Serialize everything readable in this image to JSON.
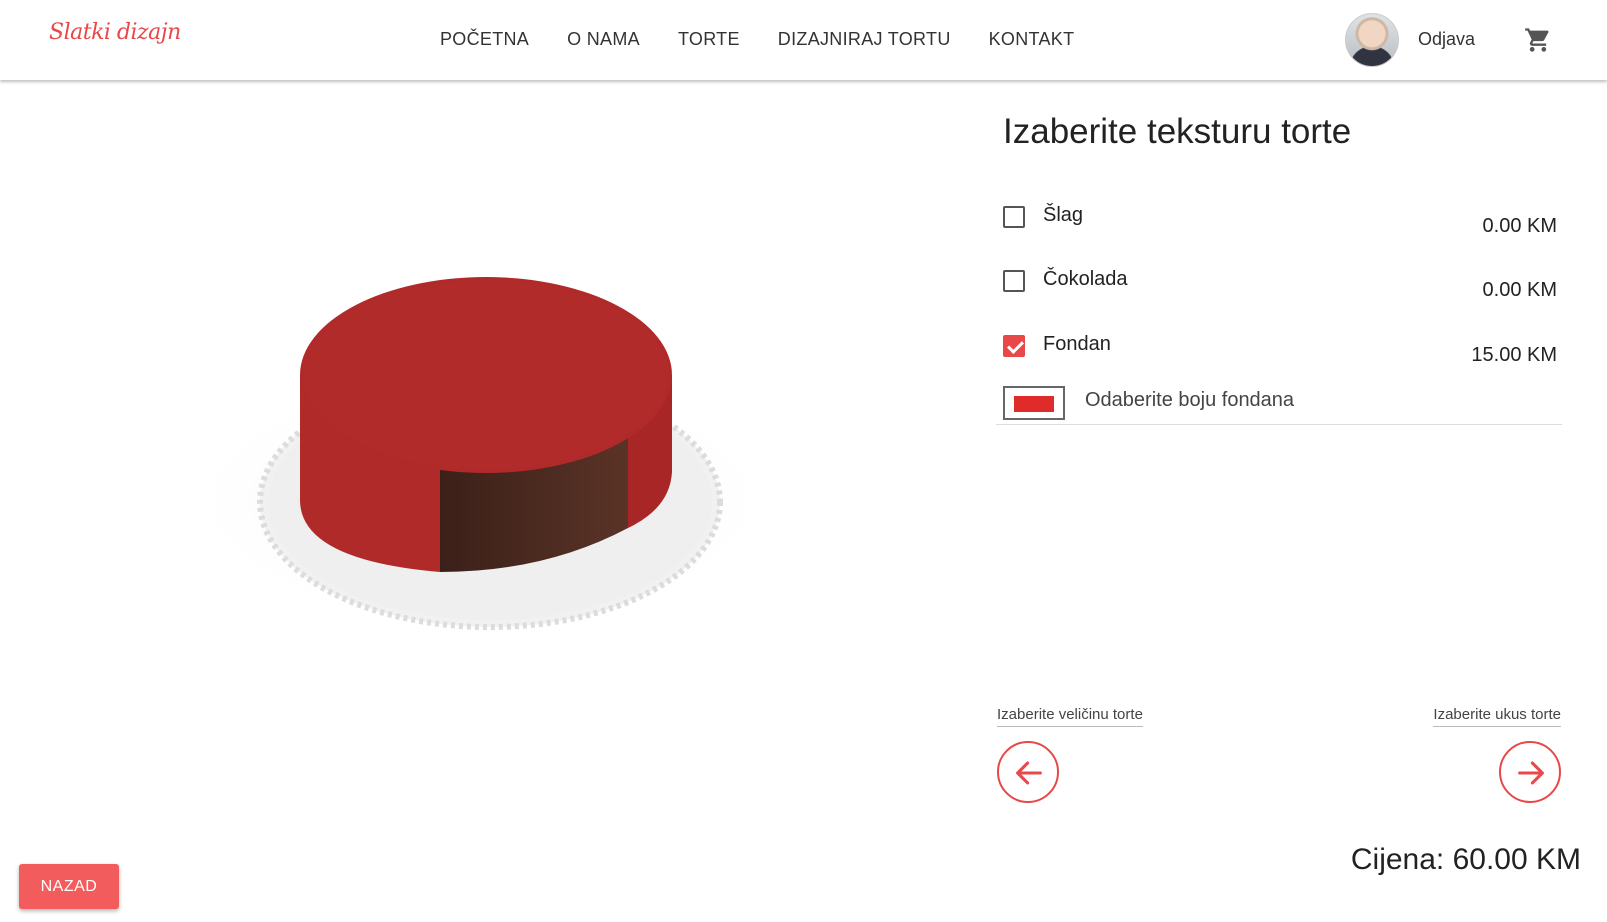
{
  "header": {
    "logo": "Slatki dizajn",
    "nav": [
      "POČETNA",
      "O NAMA",
      "TORTE",
      "DIZAJNIRAJ TORTU",
      "KONTAKT"
    ],
    "logout": "Odjava",
    "cart_icon": "shopping-cart-icon"
  },
  "panel": {
    "title": "Izaberite teksturu torte",
    "options": [
      {
        "label": "Šlag",
        "price": "0.00 KM",
        "checked": false
      },
      {
        "label": "Čokolada",
        "price": "0.00 KM",
        "checked": false
      },
      {
        "label": "Fondan",
        "price": "15.00 KM",
        "checked": true
      }
    ],
    "color_label": "Odaberite boju fondana",
    "selected_color": "#e02b2b",
    "prev_step": "Izaberite veličinu torte",
    "next_step": "Izaberite ukus torte",
    "price": "Cijena: 60.00 KM"
  },
  "footer": {
    "back": "NAZAD"
  },
  "colors": {
    "accent": "#e94848",
    "fondant": "#b02a2a",
    "sponge": "#4a2a20"
  }
}
